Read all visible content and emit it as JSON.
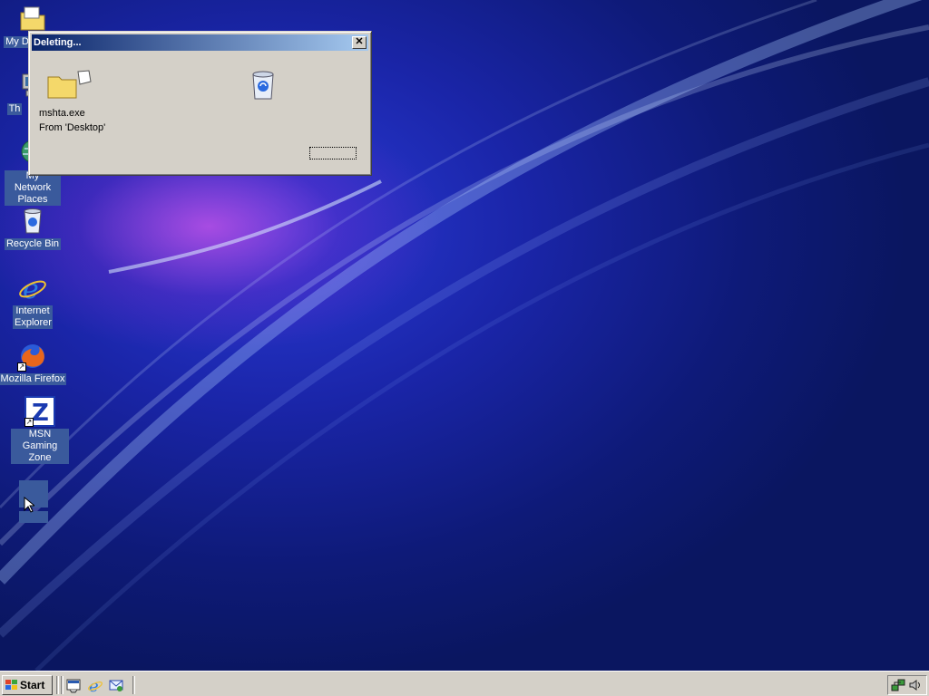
{
  "desktop": {
    "icons": [
      {
        "label": "My Documents",
        "visible_label": "My Do"
      },
      {
        "label": "This Computer",
        "visible_label": "Th"
      },
      {
        "label": "My Network Places"
      },
      {
        "label": "Recycle Bin"
      },
      {
        "label": "Internet Explorer"
      },
      {
        "label": "Mozilla Firefox"
      },
      {
        "label": "MSN Gaming Zone"
      }
    ]
  },
  "dialog": {
    "title": "Deleting...",
    "close_symbol": "✕",
    "file_name": "mshta.exe",
    "source": "From 'Desktop'",
    "source_icon": "flying-folder-icon",
    "destination_icon": "recycle-bin-icon"
  },
  "taskbar": {
    "start_label": "Start",
    "quick_launch": [
      "show-desktop-icon",
      "internet-explorer-icon",
      "outlook-express-icon"
    ],
    "tray_icons": [
      "network-icon",
      "volume-icon"
    ]
  },
  "colors": {
    "titlebar_start": "#0a246a",
    "titlebar_end": "#a6caf0",
    "dialog_face": "#d4d0c8",
    "desktop_bg": "#0e1a78"
  }
}
